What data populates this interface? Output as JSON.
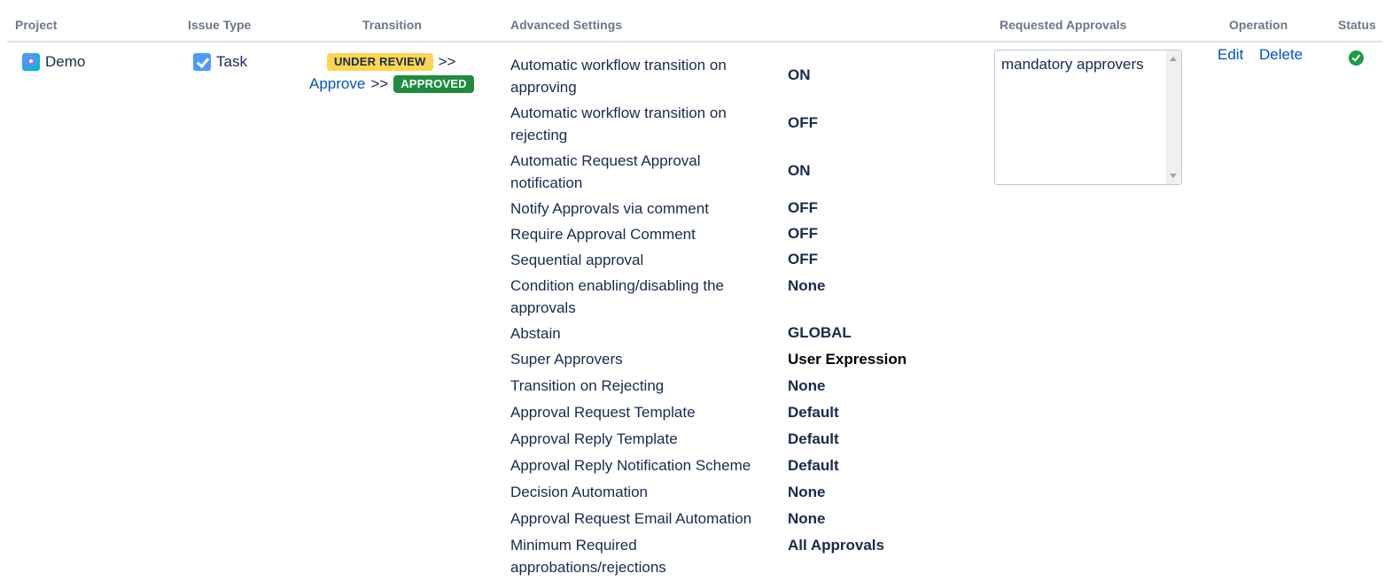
{
  "headers": {
    "project": "Project",
    "issue_type": "Issue Type",
    "transition": "Transition",
    "advanced_settings": "Advanced Settings",
    "requested_approvals": "Requested Approvals",
    "operation": "Operation",
    "status": "Status"
  },
  "row": {
    "project": {
      "name": "Demo",
      "icon": "project-avatar-icon"
    },
    "issue_type": {
      "name": "Task",
      "icon": "task-checkbox-icon"
    },
    "transition": {
      "from_status": "UNDER REVIEW",
      "arrow1": ">>",
      "action": "Approve",
      "arrow2": ">>",
      "to_status": "APPROVED",
      "colors": {
        "under_review": "#ffd54f",
        "approved": "#1f8b3e"
      }
    },
    "settings": [
      {
        "label": "Automatic workflow transition on approving",
        "value": "ON"
      },
      {
        "label": "Automatic workflow transition on rejecting",
        "value": "OFF"
      },
      {
        "label": "Automatic Request Approval notification",
        "value": "ON"
      },
      {
        "label": "Notify Approvals via comment",
        "value": "OFF"
      },
      {
        "label": "Require Approval Comment",
        "value": "OFF"
      },
      {
        "label": "Sequential approval",
        "value": "OFF"
      },
      {
        "label": "Condition enabling/disabling the approvals",
        "value": "None"
      },
      {
        "label": "Abstain",
        "value": "GLOBAL"
      },
      {
        "label": "Super Approvers",
        "value": "User Expression"
      },
      {
        "label": "Transition on Rejecting",
        "value": "None"
      },
      {
        "label": "Approval Request Template",
        "value": "Default"
      },
      {
        "label": "Approval Reply Template",
        "value": "Default"
      },
      {
        "label": "Approval Reply Notification Scheme",
        "value": "Default"
      },
      {
        "label": "Decision Automation",
        "value": "None"
      },
      {
        "label": "Approval Request Email Automation",
        "value": "None"
      },
      {
        "label": "Minimum Required approbations/rejections",
        "value": "All Approvals"
      }
    ],
    "requested_approvals": "mandatory approvers",
    "operations": {
      "edit": "Edit",
      "delete": "Delete"
    },
    "status": {
      "icon": "check-circle-icon",
      "color": "#1f9a48"
    }
  }
}
